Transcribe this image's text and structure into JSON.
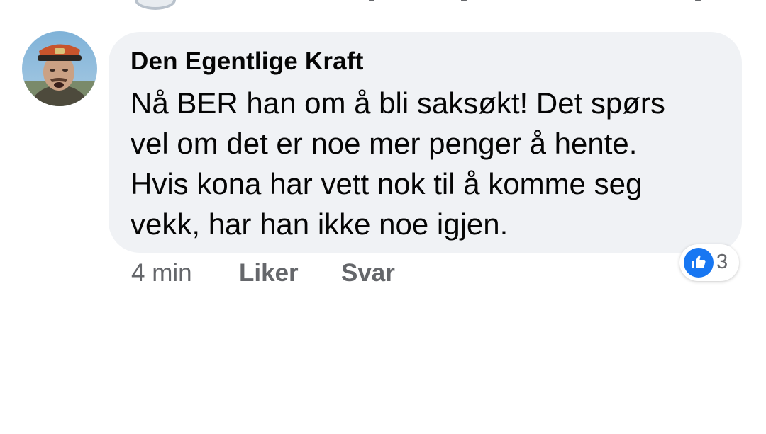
{
  "comment": {
    "author": "Den Egentlige Kraft",
    "text_lines": [
      "Nå BER han om å bli saksøkt! Det spørs",
      "vel om det er noe mer penger å hente.",
      "Hvis kona har vett nok til å komme seg",
      "vekk, har han ikke noe igjen."
    ],
    "timestamp": "4 min",
    "actions": {
      "like_label": "Liker",
      "reply_label": "Svar"
    },
    "reactions": {
      "icon": "thumbs-up-icon",
      "count": "3"
    }
  },
  "colors": {
    "bubble_bg": "#f0f2f5",
    "text": "#050505",
    "secondary_text": "#65676b",
    "like_blue": "#1877f2"
  }
}
